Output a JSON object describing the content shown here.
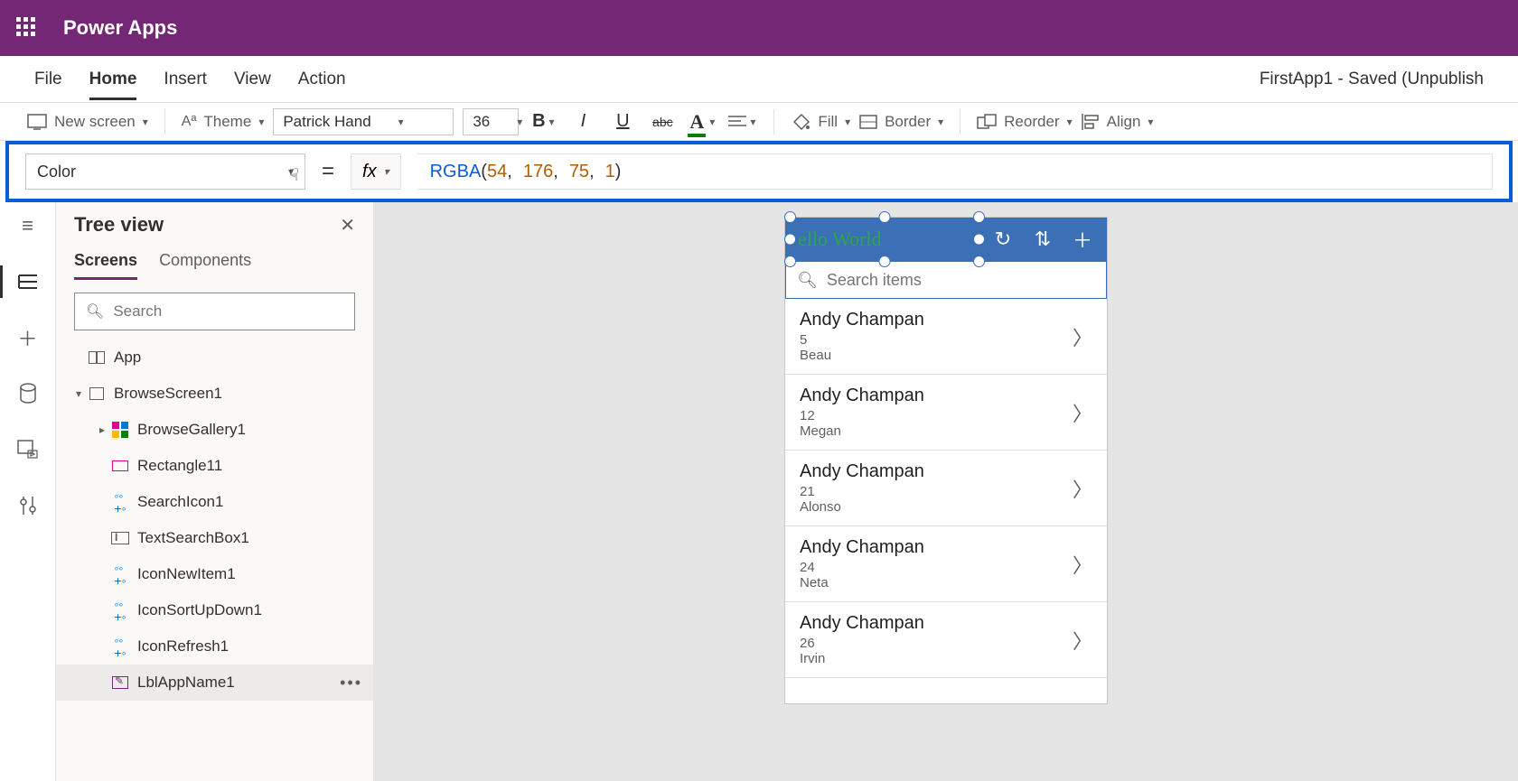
{
  "header": {
    "app_title": "Power Apps"
  },
  "menu": {
    "items": [
      "File",
      "Home",
      "Insert",
      "View",
      "Action"
    ],
    "active": "Home",
    "save_status": "FirstApp1 - Saved (Unpublish"
  },
  "ribbon": {
    "new_screen": "New screen",
    "theme": "Theme",
    "font": "Patrick Hand",
    "font_size": "36",
    "bold": "B",
    "italic": "I",
    "underline": "U",
    "strike": "abc",
    "font_color": "A",
    "fill": "Fill",
    "border": "Border",
    "reorder": "Reorder",
    "align": "Align"
  },
  "formula": {
    "property": "Color",
    "fx": "fx",
    "tokens": {
      "fn": "RGBA",
      "open": "(",
      "a": "54",
      "c": ", ",
      "b": "176",
      "d": "75",
      "e": "1",
      "close": ")"
    }
  },
  "tree": {
    "title": "Tree view",
    "tabs": [
      "Screens",
      "Components"
    ],
    "active_tab": "Screens",
    "search_placeholder": "Search",
    "nodes": [
      {
        "label": "App",
        "depth": 0,
        "icon": "app",
        "expand": ""
      },
      {
        "label": "BrowseScreen1",
        "depth": 0,
        "icon": "screen",
        "expand": "▾"
      },
      {
        "label": "BrowseGallery1",
        "depth": 1,
        "icon": "gallery",
        "expand": "▸"
      },
      {
        "label": "Rectangle11",
        "depth": 1,
        "icon": "rect",
        "expand": ""
      },
      {
        "label": "SearchIcon1",
        "depth": 1,
        "icon": "comp",
        "expand": ""
      },
      {
        "label": "TextSearchBox1",
        "depth": 1,
        "icon": "textbox",
        "expand": ""
      },
      {
        "label": "IconNewItem1",
        "depth": 1,
        "icon": "comp",
        "expand": ""
      },
      {
        "label": "IconSortUpDown1",
        "depth": 1,
        "icon": "comp",
        "expand": ""
      },
      {
        "label": "IconRefresh1",
        "depth": 1,
        "icon": "comp",
        "expand": ""
      },
      {
        "label": "LblAppName1",
        "depth": 1,
        "icon": "label",
        "expand": "",
        "selected": true
      }
    ]
  },
  "canvas": {
    "header_text": "ello World",
    "search_placeholder": "Search items",
    "items": [
      {
        "title": "Andy Champan",
        "num": "5",
        "sub": "Beau"
      },
      {
        "title": "Andy Champan",
        "num": "12",
        "sub": "Megan"
      },
      {
        "title": "Andy Champan",
        "num": "21",
        "sub": "Alonso"
      },
      {
        "title": "Andy Champan",
        "num": "24",
        "sub": "Neta"
      },
      {
        "title": "Andy Champan",
        "num": "26",
        "sub": "Irvin"
      }
    ]
  }
}
